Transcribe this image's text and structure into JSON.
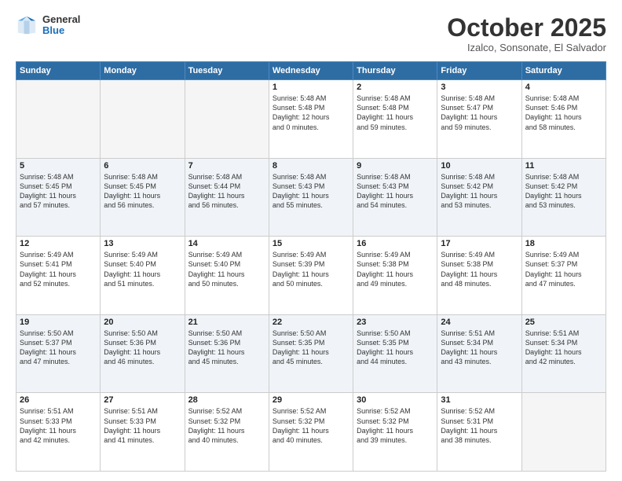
{
  "header": {
    "logo_general": "General",
    "logo_blue": "Blue",
    "month_title": "October 2025",
    "location": "Izalco, Sonsonate, El Salvador"
  },
  "days_of_week": [
    "Sunday",
    "Monday",
    "Tuesday",
    "Wednesday",
    "Thursday",
    "Friday",
    "Saturday"
  ],
  "weeks": [
    {
      "alt": false,
      "days": [
        {
          "num": "",
          "empty": true,
          "lines": []
        },
        {
          "num": "",
          "empty": true,
          "lines": []
        },
        {
          "num": "",
          "empty": true,
          "lines": []
        },
        {
          "num": "1",
          "empty": false,
          "lines": [
            "Sunrise: 5:48 AM",
            "Sunset: 5:48 PM",
            "Daylight: 12 hours",
            "and 0 minutes."
          ]
        },
        {
          "num": "2",
          "empty": false,
          "lines": [
            "Sunrise: 5:48 AM",
            "Sunset: 5:48 PM",
            "Daylight: 11 hours",
            "and 59 minutes."
          ]
        },
        {
          "num": "3",
          "empty": false,
          "lines": [
            "Sunrise: 5:48 AM",
            "Sunset: 5:47 PM",
            "Daylight: 11 hours",
            "and 59 minutes."
          ]
        },
        {
          "num": "4",
          "empty": false,
          "lines": [
            "Sunrise: 5:48 AM",
            "Sunset: 5:46 PM",
            "Daylight: 11 hours",
            "and 58 minutes."
          ]
        }
      ]
    },
    {
      "alt": true,
      "days": [
        {
          "num": "5",
          "empty": false,
          "lines": [
            "Sunrise: 5:48 AM",
            "Sunset: 5:45 PM",
            "Daylight: 11 hours",
            "and 57 minutes."
          ]
        },
        {
          "num": "6",
          "empty": false,
          "lines": [
            "Sunrise: 5:48 AM",
            "Sunset: 5:45 PM",
            "Daylight: 11 hours",
            "and 56 minutes."
          ]
        },
        {
          "num": "7",
          "empty": false,
          "lines": [
            "Sunrise: 5:48 AM",
            "Sunset: 5:44 PM",
            "Daylight: 11 hours",
            "and 56 minutes."
          ]
        },
        {
          "num": "8",
          "empty": false,
          "lines": [
            "Sunrise: 5:48 AM",
            "Sunset: 5:43 PM",
            "Daylight: 11 hours",
            "and 55 minutes."
          ]
        },
        {
          "num": "9",
          "empty": false,
          "lines": [
            "Sunrise: 5:48 AM",
            "Sunset: 5:43 PM",
            "Daylight: 11 hours",
            "and 54 minutes."
          ]
        },
        {
          "num": "10",
          "empty": false,
          "lines": [
            "Sunrise: 5:48 AM",
            "Sunset: 5:42 PM",
            "Daylight: 11 hours",
            "and 53 minutes."
          ]
        },
        {
          "num": "11",
          "empty": false,
          "lines": [
            "Sunrise: 5:48 AM",
            "Sunset: 5:42 PM",
            "Daylight: 11 hours",
            "and 53 minutes."
          ]
        }
      ]
    },
    {
      "alt": false,
      "days": [
        {
          "num": "12",
          "empty": false,
          "lines": [
            "Sunrise: 5:49 AM",
            "Sunset: 5:41 PM",
            "Daylight: 11 hours",
            "and 52 minutes."
          ]
        },
        {
          "num": "13",
          "empty": false,
          "lines": [
            "Sunrise: 5:49 AM",
            "Sunset: 5:40 PM",
            "Daylight: 11 hours",
            "and 51 minutes."
          ]
        },
        {
          "num": "14",
          "empty": false,
          "lines": [
            "Sunrise: 5:49 AM",
            "Sunset: 5:40 PM",
            "Daylight: 11 hours",
            "and 50 minutes."
          ]
        },
        {
          "num": "15",
          "empty": false,
          "lines": [
            "Sunrise: 5:49 AM",
            "Sunset: 5:39 PM",
            "Daylight: 11 hours",
            "and 50 minutes."
          ]
        },
        {
          "num": "16",
          "empty": false,
          "lines": [
            "Sunrise: 5:49 AM",
            "Sunset: 5:38 PM",
            "Daylight: 11 hours",
            "and 49 minutes."
          ]
        },
        {
          "num": "17",
          "empty": false,
          "lines": [
            "Sunrise: 5:49 AM",
            "Sunset: 5:38 PM",
            "Daylight: 11 hours",
            "and 48 minutes."
          ]
        },
        {
          "num": "18",
          "empty": false,
          "lines": [
            "Sunrise: 5:49 AM",
            "Sunset: 5:37 PM",
            "Daylight: 11 hours",
            "and 47 minutes."
          ]
        }
      ]
    },
    {
      "alt": true,
      "days": [
        {
          "num": "19",
          "empty": false,
          "lines": [
            "Sunrise: 5:50 AM",
            "Sunset: 5:37 PM",
            "Daylight: 11 hours",
            "and 47 minutes."
          ]
        },
        {
          "num": "20",
          "empty": false,
          "lines": [
            "Sunrise: 5:50 AM",
            "Sunset: 5:36 PM",
            "Daylight: 11 hours",
            "and 46 minutes."
          ]
        },
        {
          "num": "21",
          "empty": false,
          "lines": [
            "Sunrise: 5:50 AM",
            "Sunset: 5:36 PM",
            "Daylight: 11 hours",
            "and 45 minutes."
          ]
        },
        {
          "num": "22",
          "empty": false,
          "lines": [
            "Sunrise: 5:50 AM",
            "Sunset: 5:35 PM",
            "Daylight: 11 hours",
            "and 45 minutes."
          ]
        },
        {
          "num": "23",
          "empty": false,
          "lines": [
            "Sunrise: 5:50 AM",
            "Sunset: 5:35 PM",
            "Daylight: 11 hours",
            "and 44 minutes."
          ]
        },
        {
          "num": "24",
          "empty": false,
          "lines": [
            "Sunrise: 5:51 AM",
            "Sunset: 5:34 PM",
            "Daylight: 11 hours",
            "and 43 minutes."
          ]
        },
        {
          "num": "25",
          "empty": false,
          "lines": [
            "Sunrise: 5:51 AM",
            "Sunset: 5:34 PM",
            "Daylight: 11 hours",
            "and 42 minutes."
          ]
        }
      ]
    },
    {
      "alt": false,
      "days": [
        {
          "num": "26",
          "empty": false,
          "lines": [
            "Sunrise: 5:51 AM",
            "Sunset: 5:33 PM",
            "Daylight: 11 hours",
            "and 42 minutes."
          ]
        },
        {
          "num": "27",
          "empty": false,
          "lines": [
            "Sunrise: 5:51 AM",
            "Sunset: 5:33 PM",
            "Daylight: 11 hours",
            "and 41 minutes."
          ]
        },
        {
          "num": "28",
          "empty": false,
          "lines": [
            "Sunrise: 5:52 AM",
            "Sunset: 5:32 PM",
            "Daylight: 11 hours",
            "and 40 minutes."
          ]
        },
        {
          "num": "29",
          "empty": false,
          "lines": [
            "Sunrise: 5:52 AM",
            "Sunset: 5:32 PM",
            "Daylight: 11 hours",
            "and 40 minutes."
          ]
        },
        {
          "num": "30",
          "empty": false,
          "lines": [
            "Sunrise: 5:52 AM",
            "Sunset: 5:32 PM",
            "Daylight: 11 hours",
            "and 39 minutes."
          ]
        },
        {
          "num": "31",
          "empty": false,
          "lines": [
            "Sunrise: 5:52 AM",
            "Sunset: 5:31 PM",
            "Daylight: 11 hours",
            "and 38 minutes."
          ]
        },
        {
          "num": "",
          "empty": true,
          "lines": []
        }
      ]
    }
  ]
}
